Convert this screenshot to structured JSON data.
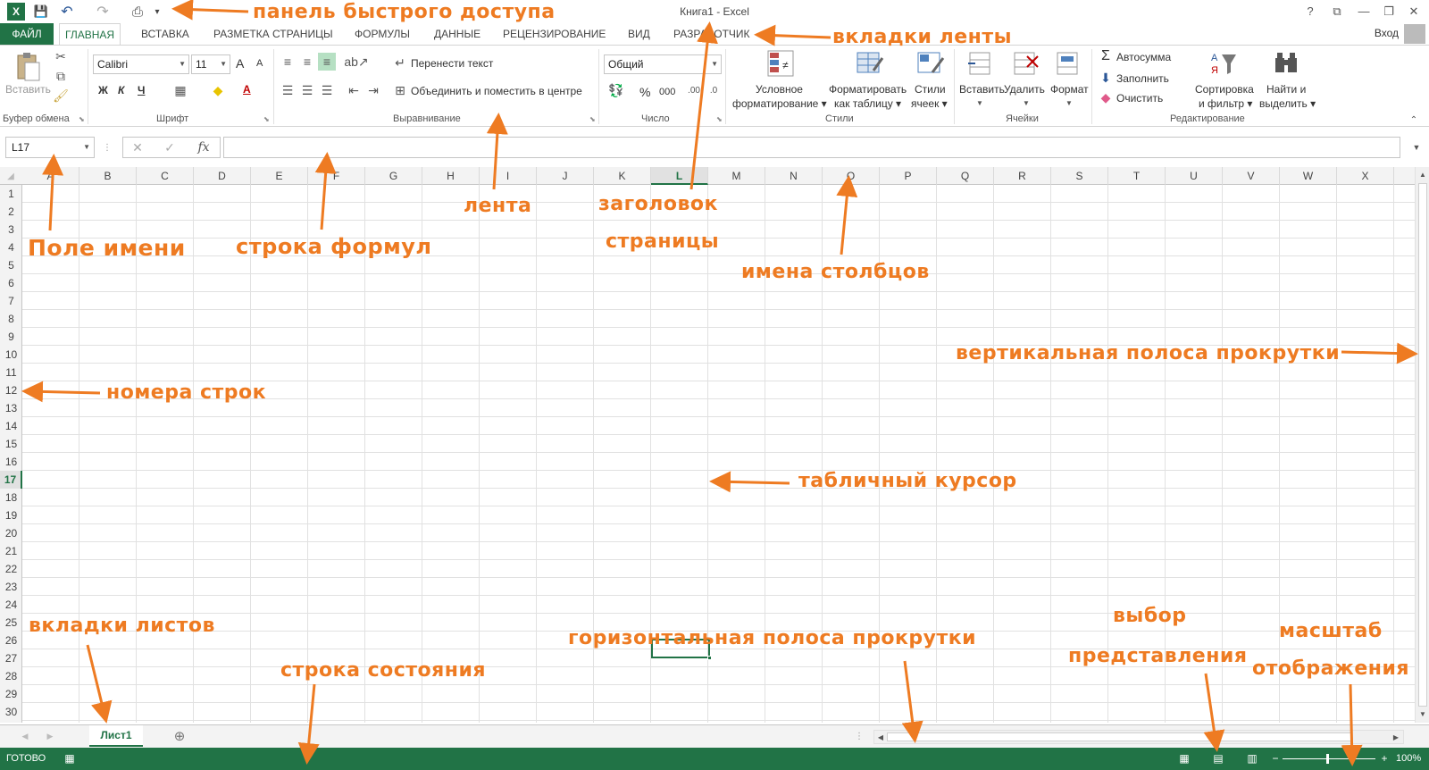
{
  "window": {
    "title": "Книга1 - Excel",
    "help": "?",
    "ribbon_display": "⧉",
    "minimize": "—",
    "restore": "❐",
    "close": "✕",
    "sign_in": "Вход"
  },
  "qat": {
    "excel_logo": "X",
    "save": "💾",
    "undo": "↶",
    "redo": "↷",
    "print_preview": "⎙",
    "customize": "▾"
  },
  "tabs": [
    {
      "label": "ФАЙЛ"
    },
    {
      "label": "ГЛАВНАЯ"
    },
    {
      "label": "ВСТАВКА"
    },
    {
      "label": "РАЗМЕТКА СТРАНИЦЫ"
    },
    {
      "label": "ФОРМУЛЫ"
    },
    {
      "label": "ДАННЫЕ"
    },
    {
      "label": "РЕЦЕНЗИРОВАНИЕ"
    },
    {
      "label": "ВИД"
    },
    {
      "label": "РАЗРАБОТЧИК"
    }
  ],
  "ribbon": {
    "clipboard": {
      "group": "Буфер обмена",
      "paste": "Вставить"
    },
    "font": {
      "group": "Шрифт",
      "name": "Calibri",
      "size": "11",
      "grow": "A",
      "shrink": "A",
      "bold": "Ж",
      "italic": "К",
      "underline": "Ч",
      "font_color": "A"
    },
    "alignment": {
      "group": "Выравнивание",
      "wrap": "Перенести текст",
      "merge": "Объединить и поместить в центре"
    },
    "number": {
      "group": "Число",
      "format": "Общий",
      "percent": "%",
      "thousands": "000"
    },
    "styles": {
      "group": "Стили",
      "cond1": "Условное",
      "cond2": "форматирование ▾",
      "table1": "Форматировать",
      "table2": "как таблицу ▾",
      "cell1": "Стили",
      "cell2": "ячеек ▾"
    },
    "cells": {
      "group": "Ячейки",
      "insert": "Вставить",
      "delete": "Удалить",
      "format": "Формат"
    },
    "editing": {
      "group": "Редактирование",
      "autosum": "Автосумма",
      "fill": "Заполнить",
      "clear": "Очистить",
      "sort1": "Сортировка",
      "sort2": "и фильтр ▾",
      "find1": "Найти и",
      "find2": "выделить ▾"
    }
  },
  "formula_bar": {
    "name_box": "L17",
    "cancel": "✕",
    "enter": "✓",
    "fx": "fx",
    "value": ""
  },
  "grid": {
    "columns": [
      "A",
      "B",
      "C",
      "D",
      "E",
      "F",
      "G",
      "H",
      "I",
      "J",
      "K",
      "L",
      "M",
      "N",
      "O",
      "P",
      "Q",
      "R",
      "S",
      "T",
      "U",
      "V",
      "W",
      "X"
    ],
    "rows": [
      "1",
      "2",
      "3",
      "4",
      "5",
      "6",
      "7",
      "8",
      "9",
      "10",
      "11",
      "12",
      "13",
      "14",
      "15",
      "16",
      "17",
      "18",
      "19",
      "20",
      "21",
      "22",
      "23",
      "24",
      "25",
      "26",
      "27",
      "28",
      "29",
      "30"
    ],
    "selected_column": "L",
    "selected_row": "17"
  },
  "sheets": {
    "active": "Лист1",
    "add": "⊕"
  },
  "status": {
    "text": "ГОТОВО",
    "zoom": "100%",
    "minus": "−",
    "plus": "+"
  },
  "annotations": {
    "qat": "панель быстрого доступа",
    "tabs": "вкладки ленты",
    "name_box": "Поле имени",
    "formula_bar": "строка формул",
    "ribbon": "лента",
    "page_title1": "заголовок",
    "page_title2": "страницы",
    "col_names": "имена столбцов",
    "vscroll": "вертикальная полоса прокрутки",
    "row_numbers": "номера строк",
    "cursor": "табличный курсор",
    "sheet_tabs": "вкладки листов",
    "status_bar": "строка состояния",
    "hscroll": "горизонтальная полоса прокрутки",
    "view1": "выбор",
    "view2": "представления",
    "zoom1": "масштаб",
    "zoom2": "отображения"
  },
  "colors": {
    "accent": "#217346",
    "annotation": "#ee7b22"
  }
}
